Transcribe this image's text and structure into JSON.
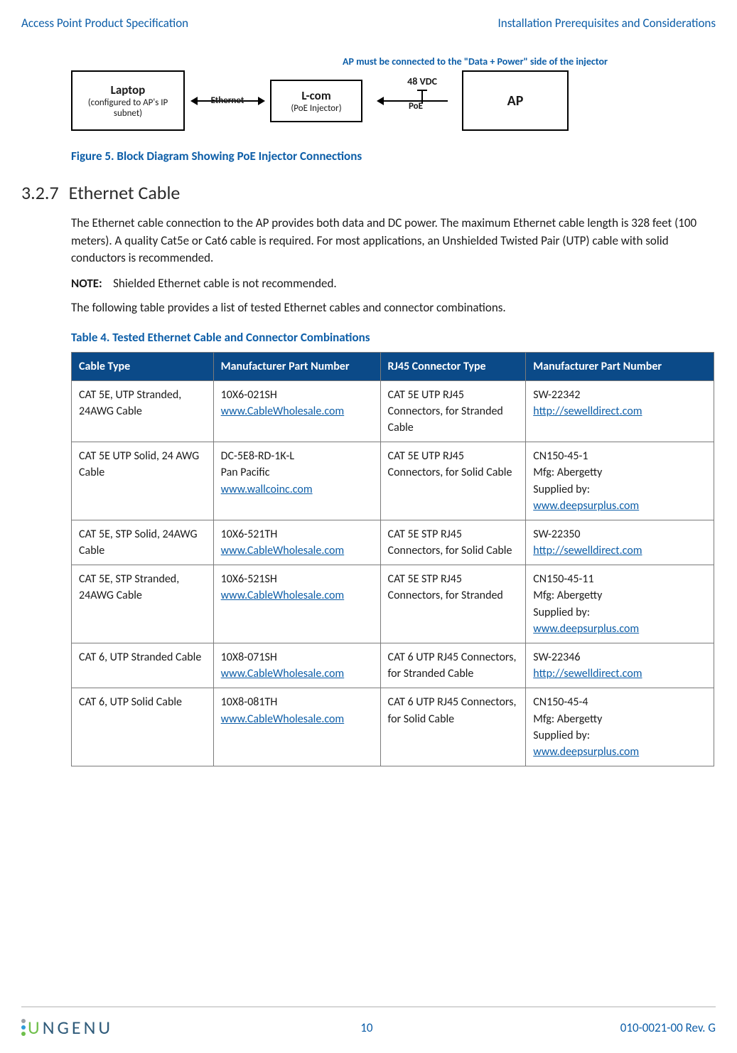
{
  "header": {
    "left": "Access Point Product Specification",
    "right": "Installation Prerequisites and Considerations"
  },
  "diagram": {
    "note": "AP must be connected to the \"Data + Power\" side of the injector",
    "laptop_title": "Laptop",
    "laptop_sub": "(configured to AP's IP subnet)",
    "conn1_label": "Ethernet",
    "lcom_title": "L-com",
    "lcom_sub": "(PoE Injector)",
    "v48_label": "48 VDC",
    "conn2_label": "PoE",
    "ap_label": "AP"
  },
  "figure_caption": "Figure 5. Block Diagram Showing PoE Injector Connections",
  "section": {
    "num": "3.2.7",
    "title": "Ethernet Cable"
  },
  "para1": "The Ethernet cable connection to the AP provides both data and DC power. The maximum Ethernet cable length is 328 feet (100 meters). A quality Cat5e or Cat6 cable is required. For most applications, an Unshielded Twisted Pair (UTP) cable with solid conductors is recommended.",
  "note_label": "NOTE:",
  "note_text": "Shielded Ethernet cable is not recommended.",
  "para2": "The following table provides a list of tested Ethernet cables and connector combinations.",
  "table_caption": "Table 4. Tested Ethernet Cable and Connector Combinations",
  "table": {
    "headers": [
      "Cable Type",
      "Manufacturer Part Number",
      "RJ45 Connector Type",
      "Manufacturer Part Number"
    ],
    "rows": [
      {
        "cable": "CAT 5E, UTP Stranded, 24AWG Cable",
        "mpn_lines": [
          "10X6-021SH"
        ],
        "mpn_links": [
          "www.CableWholesale.com"
        ],
        "conn": "CAT 5E UTP RJ45 Connectors, for Stranded Cable",
        "rj_lines": [
          "SW-22342"
        ],
        "rj_links": [
          "http://sewelldirect.com"
        ]
      },
      {
        "cable": "CAT 5E UTP Solid, 24 AWG Cable",
        "mpn_lines": [
          "DC-5E8-RD-1K-L",
          "Pan Pacific"
        ],
        "mpn_links": [
          "www.wallcoinc.com"
        ],
        "conn": "CAT 5E UTP RJ45 Connectors, for Solid Cable",
        "rj_lines": [
          "CN150-45-1",
          "Mfg: Abergetty",
          "Supplied by:"
        ],
        "rj_links": [
          "www.deepsurplus.com"
        ]
      },
      {
        "cable": "CAT 5E, STP Solid, 24AWG Cable",
        "mpn_lines": [
          "10X6-521TH"
        ],
        "mpn_links": [
          "www.CableWholesale.com"
        ],
        "conn": "CAT 5E STP RJ45 Connectors, for Solid Cable",
        "rj_lines": [
          "SW-22350"
        ],
        "rj_links": [
          "http://sewelldirect.com"
        ]
      },
      {
        "cable": "CAT 5E, STP Stranded, 24AWG Cable",
        "mpn_lines": [
          "10X6-521SH"
        ],
        "mpn_links": [
          "www.CableWholesale.com"
        ],
        "conn": "CAT 5E STP RJ45 Connectors, for Stranded",
        "rj_lines": [
          "CN150-45-11",
          "Mfg: Abergetty",
          "Supplied by:"
        ],
        "rj_links": [
          "www.deepsurplus.com"
        ]
      },
      {
        "cable": "CAT 6, UTP Stranded Cable",
        "mpn_lines": [
          "10X8-071SH"
        ],
        "mpn_links": [
          "www.CableWholesale.com"
        ],
        "conn": "CAT 6 UTP RJ45 Connectors, for Stranded Cable",
        "rj_lines": [
          "SW-22346"
        ],
        "rj_links": [
          "http://sewelldirect.com"
        ]
      },
      {
        "cable": "CAT 6, UTP Solid Cable",
        "mpn_lines": [
          "10X8-081TH"
        ],
        "mpn_links": [
          "www.CableWholesale.com"
        ],
        "conn": "CAT 6 UTP RJ45 Connectors, for Solid Cable",
        "rj_lines": [
          "CN150-45-4",
          "Mfg: Abergetty",
          "Supplied by:"
        ],
        "rj_links": [
          "www.deepsurplus.com"
        ]
      }
    ]
  },
  "footer": {
    "logo_text": "NGENU",
    "page": "10",
    "rev": "010-0021-00 Rev. G"
  }
}
